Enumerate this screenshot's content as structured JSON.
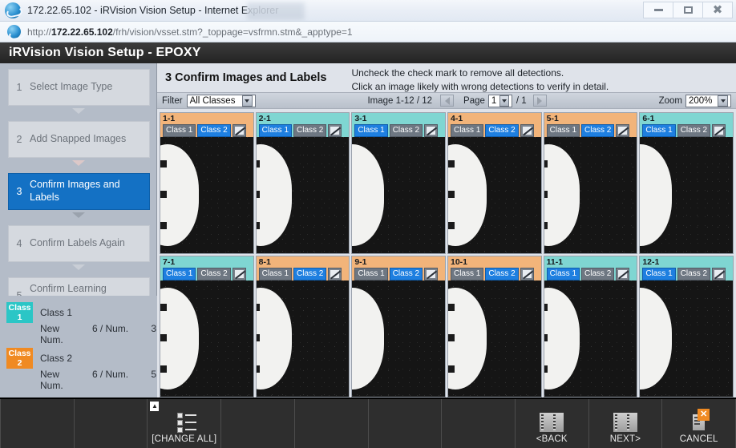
{
  "browser": {
    "window_title": "172.22.65.102 - iRVision Vision Setup - Internet Explorer",
    "url_prefix": "http://",
    "url_host": "172.22.65.102",
    "url_path": "/frh/vision/vsset.stm?_toppage=vsfrmn.stm&_apptype=1",
    "minimize": "minimize-button",
    "maximize": "maximize-button",
    "close": "close-button"
  },
  "app": {
    "title": "iRVision Vision Setup - EPOXY"
  },
  "sidebar": {
    "steps": [
      {
        "num": "1",
        "label": "Select Image Type",
        "active": false
      },
      {
        "num": "2",
        "label": "Add Snapped Images",
        "active": false
      },
      {
        "num": "3",
        "label": "Confirm Images and Labels",
        "active": true
      },
      {
        "num": "4",
        "label": "Confirm Labels Again",
        "active": false
      },
      {
        "num": "5",
        "label": "Confirm Learning Results",
        "active": false
      }
    ],
    "legend": [
      {
        "chip": "Class 1",
        "chip_color": "#2bc6c6",
        "name": "Class 1",
        "new_num_label": "New Num.",
        "new_num": "6",
        "sep": "/",
        "num_label": "Num.",
        "num": "3"
      },
      {
        "chip": "Class 2",
        "chip_color": "#f08a22",
        "name": "Class 2",
        "new_num_label": "New Num.",
        "new_num": "6",
        "sep": "/",
        "num_label": "Num.",
        "num": "5"
      }
    ]
  },
  "main": {
    "heading": "3 Confirm Images and Labels",
    "note1": "Uncheck the check mark to remove all detections.",
    "note2": "Click an image likely with wrong detections to verify in detail.",
    "filter": {
      "label": "Filter",
      "value": "All Classes"
    },
    "image_count": "Image 1-12 / 12",
    "page": {
      "label": "Page",
      "value": "1",
      "total": "/ 1"
    },
    "zoom": {
      "label": "Zoom",
      "value": "200%"
    }
  },
  "tiles": [
    {
      "id": "1-1",
      "header": "c2",
      "class1": "Class 1",
      "class2": "Class 2",
      "selected": "class2"
    },
    {
      "id": "2-1",
      "header": "c1",
      "class1": "Class 1",
      "class2": "Class 2",
      "selected": "class1"
    },
    {
      "id": "3-1",
      "header": "c1",
      "class1": "Class 1",
      "class2": "Class 2",
      "selected": "class1"
    },
    {
      "id": "4-1",
      "header": "c2",
      "class1": "Class 1",
      "class2": "Class 2",
      "selected": "class2"
    },
    {
      "id": "5-1",
      "header": "c2",
      "class1": "Class 1",
      "class2": "Class 2",
      "selected": "class2"
    },
    {
      "id": "6-1",
      "header": "c1",
      "class1": "Class 1",
      "class2": "Class 2",
      "selected": "class1"
    },
    {
      "id": "7-1",
      "header": "c1",
      "class1": "Class 1",
      "class2": "Class 2",
      "selected": "class1"
    },
    {
      "id": "8-1",
      "header": "c2",
      "class1": "Class 1",
      "class2": "Class 2",
      "selected": "class2"
    },
    {
      "id": "9-1",
      "header": "c2",
      "class1": "Class 1",
      "class2": "Class 2",
      "selected": "class2"
    },
    {
      "id": "10-1",
      "header": "c2",
      "class1": "Class 1",
      "class2": "Class 2",
      "selected": "class2"
    },
    {
      "id": "11-1",
      "header": "c1",
      "class1": "Class 1",
      "class2": "Class 2",
      "selected": "class1"
    },
    {
      "id": "12-1",
      "header": "c1",
      "class1": "Class 1",
      "class2": "Class 2",
      "selected": "class1"
    }
  ],
  "toolbar": {
    "cells": [
      {
        "label": "",
        "icon": ""
      },
      {
        "label": "",
        "icon": ""
      },
      {
        "label": "[CHANGE ALL]",
        "icon": "checklist-icon"
      },
      {
        "label": "",
        "icon": ""
      },
      {
        "label": "",
        "icon": ""
      },
      {
        "label": "",
        "icon": ""
      },
      {
        "label": "",
        "icon": ""
      },
      {
        "label": "<BACK",
        "icon": "back-arrow-icon"
      },
      {
        "label": "NEXT>",
        "icon": "next-arrow-icon"
      },
      {
        "label": "CANCEL",
        "icon": "cancel-icon"
      }
    ]
  }
}
